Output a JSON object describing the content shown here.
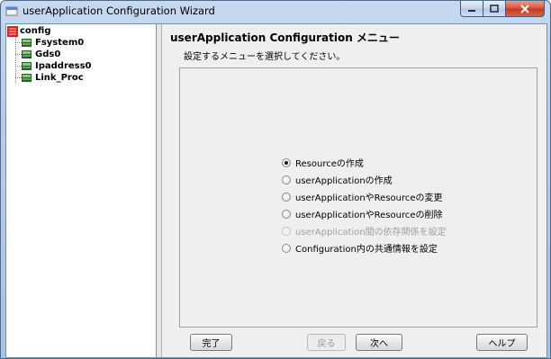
{
  "window": {
    "title": "userApplication Configuration Wizard",
    "controls": [
      "minimize",
      "maximize",
      "close"
    ]
  },
  "tree": {
    "root": {
      "label": "config",
      "icon": "config-icon"
    },
    "children": [
      {
        "label": "Fsystem0",
        "icon": "resource-icon"
      },
      {
        "label": "Gds0",
        "icon": "resource-icon"
      },
      {
        "label": "Ipaddress0",
        "icon": "resource-icon"
      },
      {
        "label": "Link_Proc",
        "icon": "resource-icon"
      }
    ]
  },
  "main": {
    "title": "userApplication Configuration メニュー",
    "subtitle": "設定するメニューを選択してください。",
    "options": [
      {
        "label": "Resourceの作成",
        "selected": true,
        "enabled": true
      },
      {
        "label": "userApplicationの作成",
        "selected": false,
        "enabled": true
      },
      {
        "label": "userApplicationやResourceの変更",
        "selected": false,
        "enabled": true
      },
      {
        "label": "userApplicationやResourceの削除",
        "selected": false,
        "enabled": true
      },
      {
        "label": "userApplication間の依存関係を設定",
        "selected": false,
        "enabled": false
      },
      {
        "label": "Configuration内の共通情報を設定",
        "selected": false,
        "enabled": true
      }
    ]
  },
  "buttons": {
    "finish": "完了",
    "back": "戻る",
    "next": "次へ",
    "help": "ヘルプ"
  },
  "colors": {
    "frame": "#b7cde9",
    "close_button": "#c53b1e",
    "disabled_text": "#a0a0a0"
  }
}
